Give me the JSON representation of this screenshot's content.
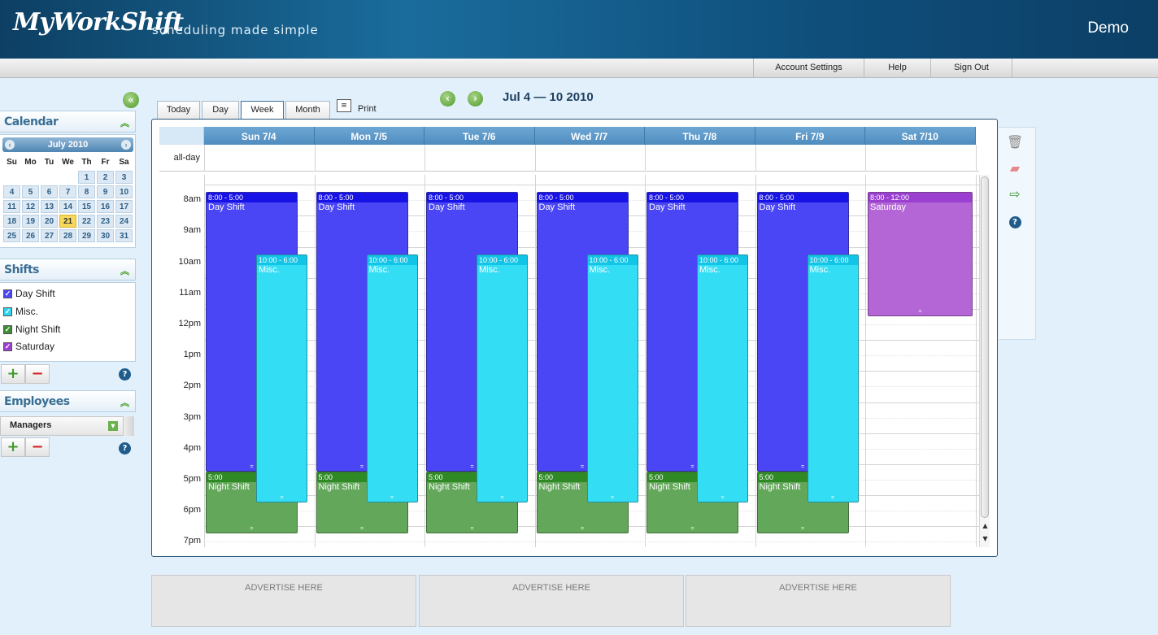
{
  "header": {
    "logo": "MyWorkShift",
    "tagline": "scheduling made simple",
    "user": "Demo"
  },
  "topnav": [
    {
      "label": "Account Settings"
    },
    {
      "label": "Help"
    },
    {
      "label": "Sign Out"
    }
  ],
  "sidebar": {
    "calendar_title": "Calendar",
    "mini_calendar": {
      "month_label": "July 2010",
      "dow": [
        "Su",
        "Mo",
        "Tu",
        "We",
        "Th",
        "Fr",
        "Sa"
      ],
      "weeks": [
        [
          "",
          "",
          "",
          "",
          "1",
          "2",
          "3"
        ],
        [
          "4",
          "5",
          "6",
          "7",
          "8",
          "9",
          "10"
        ],
        [
          "11",
          "12",
          "13",
          "14",
          "15",
          "16",
          "17"
        ],
        [
          "18",
          "19",
          "20",
          "21",
          "22",
          "23",
          "24"
        ],
        [
          "25",
          "26",
          "27",
          "28",
          "29",
          "30",
          "31"
        ]
      ],
      "today": "21"
    },
    "shifts_title": "Shifts",
    "shifts": [
      {
        "label": "Day Shift",
        "color": "#4a46f5"
      },
      {
        "label": "Misc.",
        "color": "#2ed3ef"
      },
      {
        "label": "Night Shift",
        "color": "#3f8a34"
      },
      {
        "label": "Saturday",
        "color": "#9a3fd0"
      }
    ],
    "employees_title": "Employees",
    "employee_group": "Managers"
  },
  "toolbar": {
    "tabs": [
      {
        "label": "Today"
      },
      {
        "label": "Day"
      },
      {
        "label": "Week",
        "active": true
      },
      {
        "label": "Month"
      }
    ],
    "print_label": "Print",
    "date_range": "Jul 4 — 10 2010"
  },
  "calendar": {
    "allday_label": "all-day",
    "days": [
      "Sun 7/4",
      "Mon 7/5",
      "Tue 7/6",
      "Wed 7/7",
      "Thu 7/8",
      "Fri 7/9",
      "Sat 7/10"
    ],
    "hours": [
      "8am",
      "9am",
      "10am",
      "11am",
      "12pm",
      "1pm",
      "2pm",
      "3pm",
      "4pm",
      "5pm",
      "6pm",
      "7pm"
    ],
    "events": [
      {
        "day": 0,
        "start": 8,
        "end": 17,
        "time": "8:00 - 5:00",
        "title": "Day Shift",
        "color": "#4a46f5",
        "header": "#1713e6",
        "lane": "left"
      },
      {
        "day": 0,
        "start": 10,
        "end": 18,
        "time": "10:00 - 6:00",
        "title": "Misc.",
        "color": "#33ddf4",
        "header": "#12c4e6",
        "lane": "right"
      },
      {
        "day": 0,
        "start": 17,
        "end": 19,
        "time": "5:00",
        "title": "Night Shift",
        "color": "#63a75a",
        "header": "#2f8a26",
        "lane": "left"
      },
      {
        "day": 1,
        "start": 8,
        "end": 17,
        "time": "8:00 - 5:00",
        "title": "Day Shift",
        "color": "#4a46f5",
        "header": "#1713e6",
        "lane": "left"
      },
      {
        "day": 1,
        "start": 10,
        "end": 18,
        "time": "10:00 - 6:00",
        "title": "Misc.",
        "color": "#33ddf4",
        "header": "#12c4e6",
        "lane": "right"
      },
      {
        "day": 1,
        "start": 17,
        "end": 19,
        "time": "5:00",
        "title": "Night Shift",
        "color": "#63a75a",
        "header": "#2f8a26",
        "lane": "left"
      },
      {
        "day": 2,
        "start": 8,
        "end": 17,
        "time": "8:00 - 5:00",
        "title": "Day Shift",
        "color": "#4a46f5",
        "header": "#1713e6",
        "lane": "left"
      },
      {
        "day": 2,
        "start": 10,
        "end": 18,
        "time": "10:00 - 6:00",
        "title": "Misc.",
        "color": "#33ddf4",
        "header": "#12c4e6",
        "lane": "right"
      },
      {
        "day": 2,
        "start": 17,
        "end": 19,
        "time": "5:00",
        "title": "Night Shift",
        "color": "#63a75a",
        "header": "#2f8a26",
        "lane": "left"
      },
      {
        "day": 3,
        "start": 8,
        "end": 17,
        "time": "8:00 - 5:00",
        "title": "Day Shift",
        "color": "#4a46f5",
        "header": "#1713e6",
        "lane": "left"
      },
      {
        "day": 3,
        "start": 10,
        "end": 18,
        "time": "10:00 - 6:00",
        "title": "Misc.",
        "color": "#33ddf4",
        "header": "#12c4e6",
        "lane": "right"
      },
      {
        "day": 3,
        "start": 17,
        "end": 19,
        "time": "5:00",
        "title": "Night Shift",
        "color": "#63a75a",
        "header": "#2f8a26",
        "lane": "left"
      },
      {
        "day": 4,
        "start": 8,
        "end": 17,
        "time": "8:00 - 5:00",
        "title": "Day Shift",
        "color": "#4a46f5",
        "header": "#1713e6",
        "lane": "left"
      },
      {
        "day": 4,
        "start": 10,
        "end": 18,
        "time": "10:00 - 6:00",
        "title": "Misc.",
        "color": "#33ddf4",
        "header": "#12c4e6",
        "lane": "right"
      },
      {
        "day": 4,
        "start": 17,
        "end": 19,
        "time": "5:00",
        "title": "Night Shift",
        "color": "#63a75a",
        "header": "#2f8a26",
        "lane": "left"
      },
      {
        "day": 5,
        "start": 8,
        "end": 17,
        "time": "8:00 - 5:00",
        "title": "Day Shift",
        "color": "#4a46f5",
        "header": "#1713e6",
        "lane": "left"
      },
      {
        "day": 5,
        "start": 10,
        "end": 18,
        "time": "10:00 - 6:00",
        "title": "Misc.",
        "color": "#33ddf4",
        "header": "#12c4e6",
        "lane": "right"
      },
      {
        "day": 5,
        "start": 17,
        "end": 19,
        "time": "5:00",
        "title": "Night Shift",
        "color": "#63a75a",
        "header": "#2f8a26",
        "lane": "left"
      },
      {
        "day": 6,
        "start": 8,
        "end": 12,
        "time": "8:00 - 12:00",
        "title": "Saturday",
        "color": "#b466d6",
        "header": "#9a3fd0",
        "lane": "full"
      }
    ]
  },
  "ads": [
    "ADVERTISE HERE",
    "ADVERTISE HERE",
    "ADVERTISE HERE"
  ]
}
